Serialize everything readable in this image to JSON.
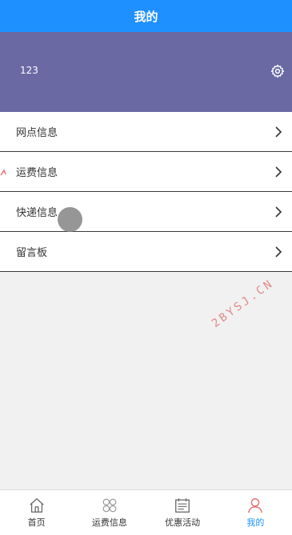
{
  "header": {
    "title": "我的"
  },
  "profile": {
    "username": "123",
    "settings_icon": "gear-icon"
  },
  "menu": {
    "items": [
      {
        "label": "网点信息",
        "icon": "chevron-right-icon"
      },
      {
        "label": "运费信息",
        "icon": "chevron-right-icon"
      },
      {
        "label": "快递信息",
        "icon": "chevron-right-icon"
      },
      {
        "label": "留言板",
        "icon": "chevron-right-icon"
      }
    ]
  },
  "watermark": {
    "text": "2BYSJ.CN"
  },
  "tabbar": {
    "tabs": [
      {
        "label": "首页",
        "icon": "home-icon",
        "active": false
      },
      {
        "label": "运费信息",
        "icon": "grid-icon",
        "active": false
      },
      {
        "label": "优惠活动",
        "icon": "calendar-icon",
        "active": false
      },
      {
        "label": "我的",
        "icon": "user-icon",
        "active": true
      }
    ]
  },
  "colors": {
    "header_bg": "#1e90ff",
    "profile_bg": "#6a69a4",
    "active_tab": "#1e90ff",
    "active_icon": "#e57373",
    "watermark": "#e08a8a"
  }
}
